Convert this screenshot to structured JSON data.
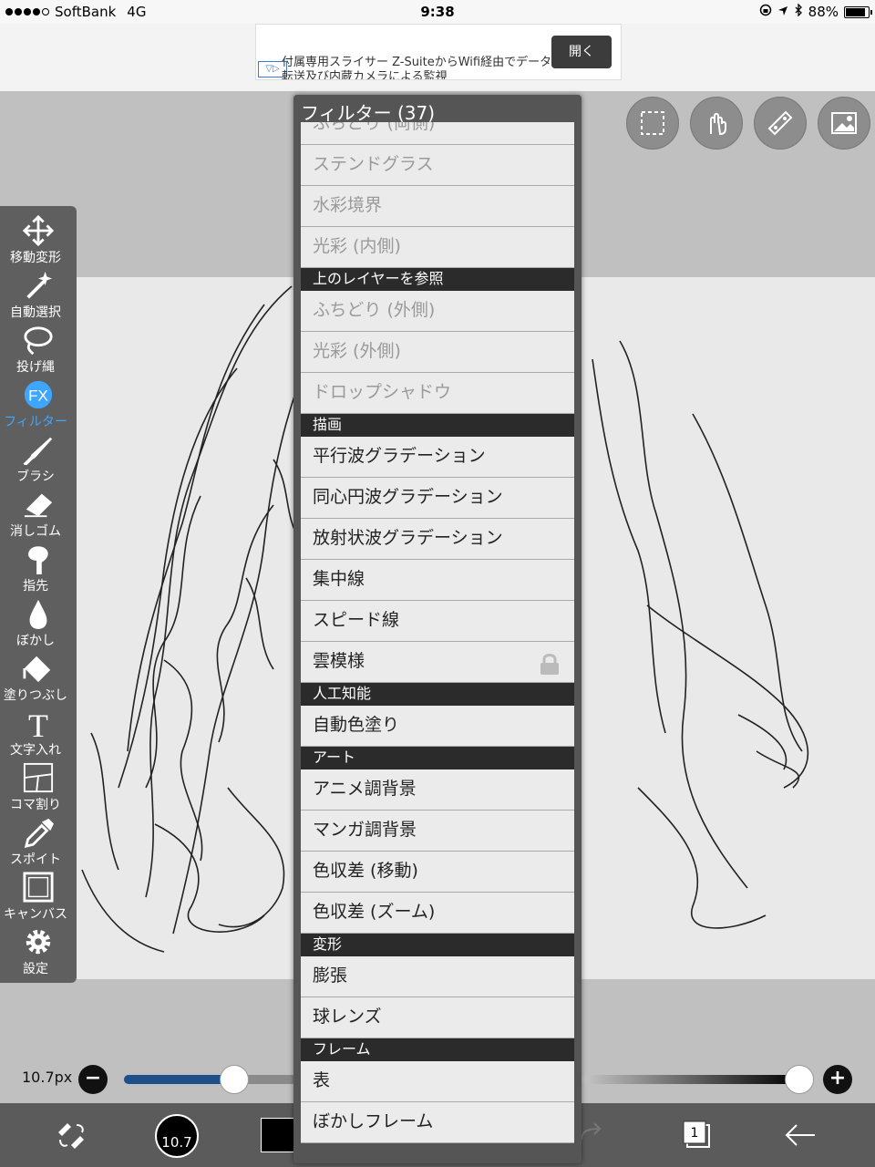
{
  "status_bar": {
    "signal_dots": 5,
    "signal_filled": 4,
    "carrier": "SoftBank",
    "network": "4G",
    "time": "9:38",
    "battery": "88%",
    "battery_level": 0.88
  },
  "ad": {
    "text": "付属専用スライサー Z-SuiteからWifi経由でデータ転送及び内蔵カメラによる監視",
    "open_button": "開く"
  },
  "toolbar": {
    "items": [
      {
        "label": "移動変形",
        "icon": "move-icon"
      },
      {
        "label": "自動選択",
        "icon": "magic-wand-icon"
      },
      {
        "label": "投げ縄",
        "icon": "lasso-icon"
      },
      {
        "label": "フィルター",
        "icon": "fx-icon",
        "active": true
      },
      {
        "label": "ブラシ",
        "icon": "brush-icon"
      },
      {
        "label": "消しゴム",
        "icon": "eraser-icon"
      },
      {
        "label": "指先",
        "icon": "finger-icon"
      },
      {
        "label": "ぼかし",
        "icon": "blur-drop-icon"
      },
      {
        "label": "塗りつぶし",
        "icon": "fill-bucket-icon"
      },
      {
        "label": "文字入れ",
        "icon": "text-icon"
      },
      {
        "label": "コマ割り",
        "icon": "panel-divide-icon"
      },
      {
        "label": "スポイト",
        "icon": "eyedropper-icon"
      },
      {
        "label": "キャンバス",
        "icon": "canvas-icon"
      },
      {
        "label": "設定",
        "icon": "gear-icon"
      }
    ]
  },
  "top_tools": [
    "selection-icon",
    "hand-gesture-icon",
    "ruler-icon",
    "image-icon"
  ],
  "brush": {
    "size_label": "10.7px",
    "size_value": 10.7,
    "size_fraction": 0.6,
    "opacity_fraction": 1.0,
    "minus": "−",
    "plus": "+"
  },
  "bottom_bar": {
    "brush_size_badge": "10.7",
    "layer_count": "1"
  },
  "filter_panel": {
    "title": "フィルター (37)",
    "rows": [
      {
        "type": "item",
        "label": "ふちどり (両側)",
        "disabled": true
      },
      {
        "type": "item",
        "label": "ステンドグラス",
        "disabled": true
      },
      {
        "type": "item",
        "label": "水彩境界",
        "disabled": true
      },
      {
        "type": "item",
        "label": "光彩 (内側)",
        "disabled": true
      },
      {
        "type": "header",
        "label": "上のレイヤーを参照"
      },
      {
        "type": "item",
        "label": "ふちどり (外側)",
        "disabled": true
      },
      {
        "type": "item",
        "label": "光彩 (外側)",
        "disabled": true
      },
      {
        "type": "item",
        "label": "ドロップシャドウ",
        "disabled": true
      },
      {
        "type": "header",
        "label": "描画"
      },
      {
        "type": "item",
        "label": "平行波グラデーション"
      },
      {
        "type": "item",
        "label": "同心円波グラデーション"
      },
      {
        "type": "item",
        "label": "放射状波グラデーション"
      },
      {
        "type": "item",
        "label": "集中線"
      },
      {
        "type": "item",
        "label": "スピード線"
      },
      {
        "type": "item",
        "label": "雲模様",
        "locked": true
      },
      {
        "type": "header",
        "label": "人工知能"
      },
      {
        "type": "item",
        "label": "自動色塗り"
      },
      {
        "type": "header",
        "label": "アート"
      },
      {
        "type": "item",
        "label": "アニメ調背景"
      },
      {
        "type": "item",
        "label": "マンガ調背景"
      },
      {
        "type": "item",
        "label": "色収差 (移動)"
      },
      {
        "type": "item",
        "label": "色収差 (ズーム)"
      },
      {
        "type": "header",
        "label": "変形"
      },
      {
        "type": "item",
        "label": "膨張"
      },
      {
        "type": "item",
        "label": "球レンズ"
      },
      {
        "type": "header",
        "label": "フレーム"
      },
      {
        "type": "item",
        "label": "表"
      },
      {
        "type": "item",
        "label": "ぼかしフレーム"
      }
    ]
  }
}
